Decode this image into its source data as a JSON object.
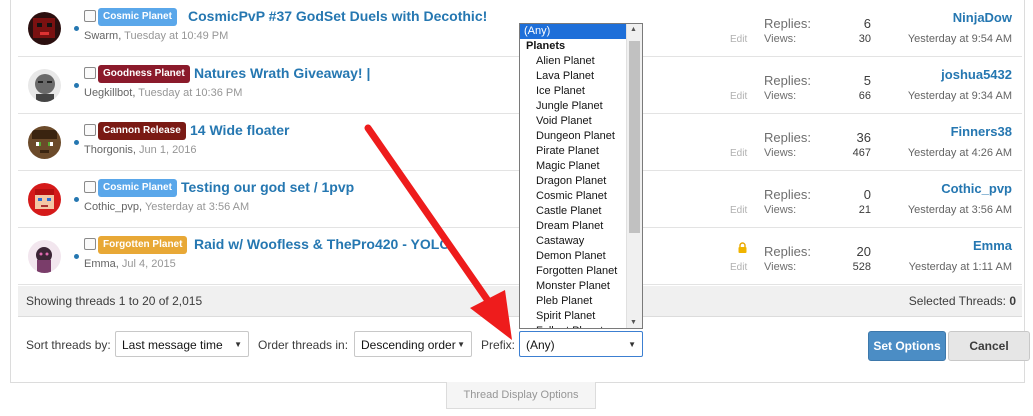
{
  "threads": [
    {
      "prefix": "Cosmic Planet",
      "prefix_color": "#5aa7ea",
      "title": "CosmicPvP #37 GodSet Duels with Decothic!",
      "author": "Swarm",
      "date": "Tuesday at 10:49 PM",
      "edit": "Edit",
      "replies_label": "Replies:",
      "replies": "6",
      "views_label": "Views:",
      "views": "30",
      "last_user": "NinjaDow",
      "last_time": "Yesterday at 9:54 AM",
      "locked": false
    },
    {
      "prefix": "Goodness Planet",
      "prefix_color": "#8b1a2b",
      "title": "Natures Wrath Giveaway! |",
      "author": "Uegkillbot",
      "date": "Tuesday at 10:36 PM",
      "edit": "Edit",
      "replies_label": "Replies:",
      "replies": "5",
      "views_label": "Views:",
      "views": "66",
      "last_user": "joshua5432",
      "last_time": "Yesterday at 9:34 AM",
      "locked": false
    },
    {
      "prefix": "Cannon Release",
      "prefix_color": "#7a1a14",
      "title": "14 Wide floater",
      "author": "Thorgonis",
      "date": "Jun 1, 2016",
      "edit": "Edit",
      "replies_label": "Replies:",
      "replies": "36",
      "views_label": "Views:",
      "views": "467",
      "last_user": "Finners38",
      "last_time": "Yesterday at 4:26 AM",
      "locked": false
    },
    {
      "prefix": "Cosmic Planet",
      "prefix_color": "#5aa7ea",
      "title": "Testing our god set / 1pvp",
      "author": "Cothic_pvp",
      "date": "Yesterday at 3:56 AM",
      "edit": "Edit",
      "replies_label": "Replies:",
      "replies": "0",
      "views_label": "Views:",
      "views": "21",
      "last_user": "Cothic_pvp",
      "last_time": "Yesterday at 3:56 AM",
      "locked": false
    },
    {
      "prefix": "Forgotten Planet",
      "prefix_color": "#e8a836",
      "title": "Raid w/ Woofless & ThePro420 - YOLO",
      "author": "Emma",
      "date": "Jul 4, 2015",
      "edit": "Edit",
      "replies_label": "Replies:",
      "replies": "20",
      "views_label": "Views:",
      "views": "528",
      "last_user": "Emma",
      "last_time": "Yesterday at 1:11 AM",
      "locked": true
    }
  ],
  "footer": {
    "showing": "Showing threads 1 to 20 of 2,015",
    "selected_label": "Selected Threads:",
    "selected_count": "0"
  },
  "options": {
    "sort_label": "Sort threads by:",
    "sort_value": "Last message time",
    "order_label": "Order threads in:",
    "order_value": "Descending order",
    "prefix_label": "Prefix:",
    "prefix_value": "(Any)",
    "set_button": "Set Options",
    "cancel_button": "Cancel"
  },
  "dropdown": {
    "selected": "(Any)",
    "group": "Planets",
    "items": [
      "Alien Planet",
      "Lava Planet",
      "Ice Planet",
      "Jungle Planet",
      "Void Planet",
      "Dungeon Planet",
      "Pirate Planet",
      "Magic Planet",
      "Dragon Planet",
      "Cosmic Planet",
      "Castle Planet",
      "Dream Planet",
      "Castaway",
      "Demon Planet",
      "Forgotten Planet",
      "Monster Planet",
      "Pleb Planet",
      "Spirit Planet",
      "Fallout Planet"
    ]
  },
  "tab_label": "Thread Display Options",
  "colors": {
    "link": "#2577b1",
    "arrow": "#ee1c1c",
    "primary_button": "#4b8dc5"
  }
}
